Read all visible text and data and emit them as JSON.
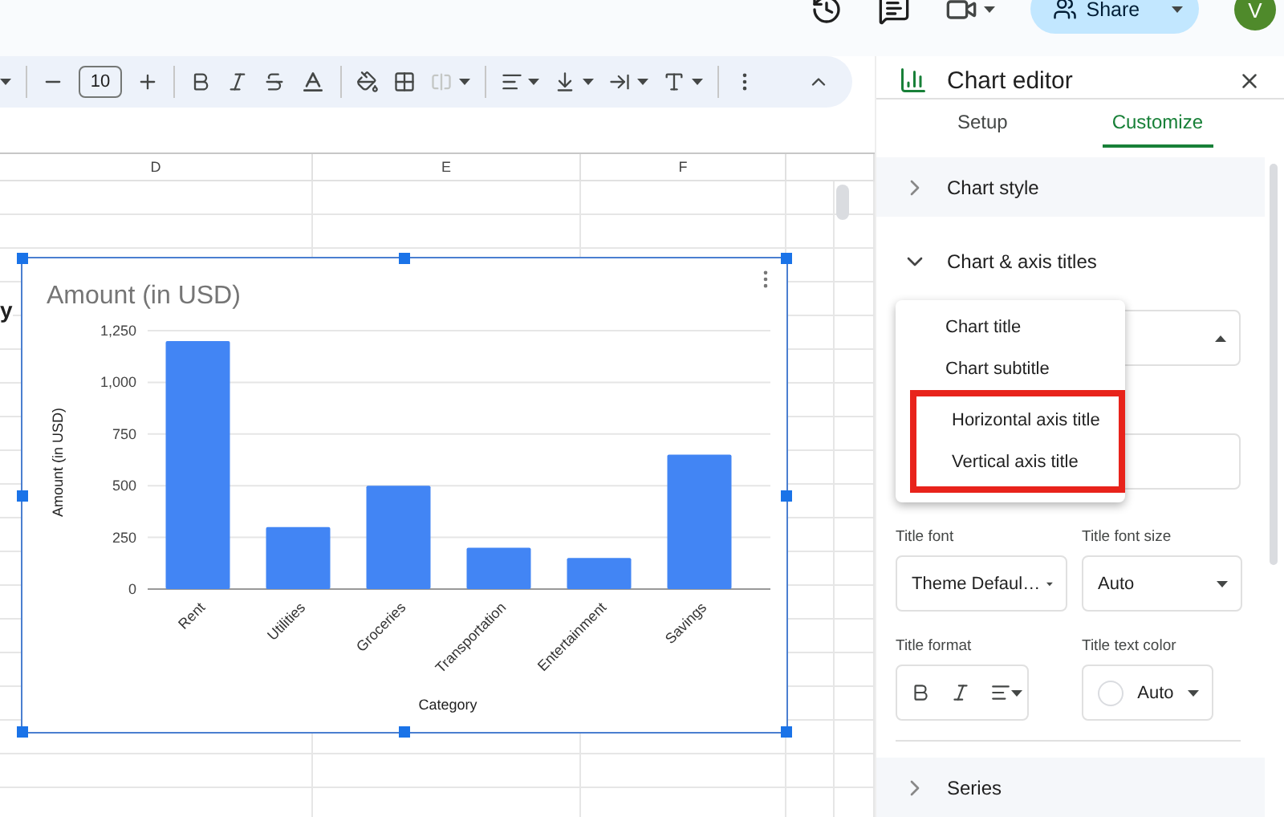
{
  "top_bar": {
    "share_button": "Share",
    "avatar": "V"
  },
  "toolbar": {
    "font_size": "10"
  },
  "column_headers": [
    "D",
    "E",
    "F"
  ],
  "cell_text": "y",
  "chart": {
    "chart_data": {
      "type": "bar",
      "title": "Amount (in USD)",
      "xlabel": "Category",
      "ylabel": "Amount (in USD)",
      "categories": [
        "Rent",
        "Utilities",
        "Groceries",
        "Transportation",
        "Entertainment",
        "Savings"
      ],
      "series": [
        {
          "color": "#4285f4",
          "values": [
            1200,
            300,
            500,
            200,
            150,
            650
          ]
        }
      ],
      "grid": true,
      "ylim": [
        0,
        1250
      ],
      "yticks": [
        0,
        250,
        500,
        750,
        {
          "value": 1000,
          "label": "1,000"
        },
        {
          "value": 1250,
          "label": "1,250"
        }
      ]
    }
  },
  "chart_editor": {
    "title": "Chart editor",
    "tabs": [
      {
        "label": "Setup",
        "selected": false
      },
      {
        "label": "Customize",
        "selected": true
      }
    ],
    "sections": [
      {
        "label": "Chart style",
        "expanded": false
      },
      {
        "label": "Chart & axis titles",
        "expanded": true
      }
    ],
    "title_menu": [
      {
        "label": "Chart title",
        "highlighted": false
      },
      {
        "label": "Chart subtitle",
        "highlighted": false
      },
      {
        "label": "Horizontal axis title",
        "highlighted": true
      },
      {
        "label": "Vertical axis title",
        "highlighted": true
      }
    ],
    "title_font": {
      "label": "Title font",
      "value": "Theme Defaul…"
    },
    "title_font_size": {
      "label": "Title font size",
      "value": "Auto"
    },
    "title_format": {
      "label": "Title format"
    },
    "title_text_color": {
      "label": "Title text color",
      "value": "Auto"
    },
    "next_section": {
      "label": "Series",
      "expanded": false
    }
  }
}
